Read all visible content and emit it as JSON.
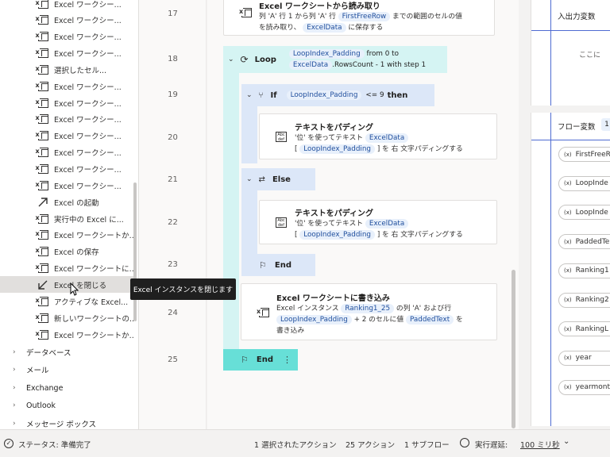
{
  "actions_panel": {
    "items": [
      {
        "label": "Excel ワークシー...",
        "icon": "excel-icon"
      },
      {
        "label": "Excel ワークシー...",
        "icon": "excel-icon"
      },
      {
        "label": "Excel ワークシー...",
        "icon": "excel-icon"
      },
      {
        "label": "Excel ワークシー...",
        "icon": "excel-icon"
      },
      {
        "label": "選択したセル...",
        "icon": "excel-icon"
      },
      {
        "label": "Excel ワークシー...",
        "icon": "excel-icon"
      },
      {
        "label": "Excel ワークシー...",
        "icon": "excel-icon"
      },
      {
        "label": "Excel ワークシー...",
        "icon": "excel-icon"
      },
      {
        "label": "Excel ワークシー...",
        "icon": "excel-icon"
      },
      {
        "label": "Excel ワークシー...",
        "icon": "excel-icon"
      },
      {
        "label": "Excel ワークシー...",
        "icon": "excel-icon"
      },
      {
        "label": "Excel ワークシー...",
        "icon": "excel-icon"
      },
      {
        "label": "Excel の起動",
        "icon": "launch-arrow-icon"
      },
      {
        "label": "実行中の Excel に...",
        "icon": "excel-icon"
      },
      {
        "label": "Excel ワークシートか...",
        "icon": "excel-icon"
      },
      {
        "label": "Excel の保存",
        "icon": "excel-icon"
      },
      {
        "label": "Excel ワークシートに...",
        "icon": "excel-icon"
      },
      {
        "label": "Excel を閉じる",
        "icon": "close-arrow-icon"
      },
      {
        "label": "アクティブな Excel...",
        "icon": "excel-icon"
      },
      {
        "label": "新しいワークシートの...",
        "icon": "excel-icon"
      },
      {
        "label": "Excel ワークシートか...",
        "icon": "excel-icon"
      }
    ],
    "groups": [
      "データベース",
      "メール",
      "Exchange",
      "Outlook",
      "メッセージ ボックス"
    ]
  },
  "tooltip": "Excel インスタンスを閉じます",
  "flow": {
    "line_numbers": [
      "17",
      "18",
      "19",
      "20",
      "21",
      "22",
      "23",
      "24",
      "25"
    ],
    "step17": {
      "title": "Excel ワークシートから読み取り",
      "d1": "列 'A' 行 1 から列 'A' 行",
      "tok1": "FirstFreeRow",
      "d2": "までの範囲のセルの値",
      "d3": "を読み取り、",
      "tok2": "ExcelData",
      "d4": "に保存する"
    },
    "loop": {
      "keyword": "Loop",
      "tok1": "LoopIndex_Padding",
      "t1": "from 0 to",
      "tok2": "ExcelData",
      "t2": ".RowsCount - 1 with step 1"
    },
    "if_block": {
      "keyword": "If",
      "tok": "LoopIndex_Padding",
      "cond": "<= 9",
      "then": "then"
    },
    "pad1": {
      "title": "テキストをパディング",
      "d1": "'位' を使ってテキスト",
      "tok1": "ExcelData",
      "d2": "[",
      "tok2": "LoopIndex_Padding",
      "d3": "] を 右 文字パディングする"
    },
    "else_block": {
      "keyword": "Else"
    },
    "pad2": {
      "title": "テキストをパディング",
      "d1": "'位' を使ってテキスト",
      "tok1": "ExcelData",
      "d2": "[",
      "tok2": "LoopIndex_Padding",
      "d3": "] を 右 文字パディングする"
    },
    "end_inner": "End",
    "write": {
      "title": "Excel ワークシートに書き込み",
      "d1": "Excel インスタンス",
      "tok1": "Ranking1_25",
      "d2": "の列 'A' および行",
      "tok2": "LoopIndex_Padding",
      "d3": "+ 2 のセルに値",
      "tok3": "PaddedText",
      "d4": "を",
      "d5": "書き込み"
    },
    "end_outer": "End"
  },
  "right_panel": {
    "io_title": "入出力変数",
    "io_hint": "ここに",
    "flow_vars_title": "フロー変数",
    "flow_vars_count": "1",
    "variables": [
      "FirstFreeR",
      "LoopInde",
      "LoopInde",
      "PaddedTe",
      "Ranking1",
      "Ranking2",
      "RankingL",
      "year",
      "yearmont"
    ],
    "var_icon": "(x)"
  },
  "status_bar": {
    "status": "ステータス: 準備完了",
    "selected": "1 選択されたアクション",
    "actions": "25 アクション",
    "subflows": "1 サブフロー",
    "delay_label": "実行遅延:",
    "delay_value": "100 ミリ秒"
  }
}
